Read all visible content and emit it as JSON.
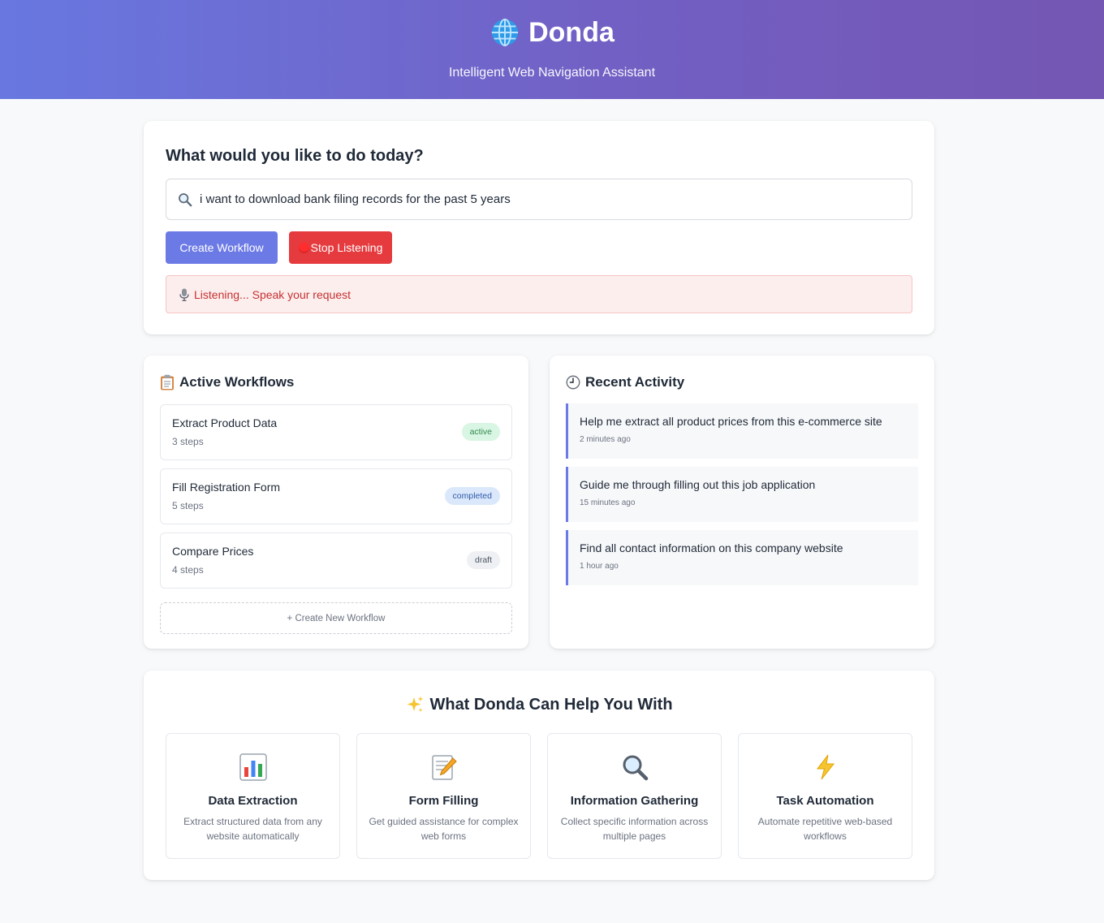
{
  "header": {
    "title": "Donda",
    "tagline": "Intelligent Web Navigation Assistant",
    "logo_icon": "globe-icon"
  },
  "query": {
    "title": "What would you like to do today?",
    "input_value": "i want to download bank filing records for the past 5 years",
    "search_icon": "search-icon",
    "create_button": "Create Workflow",
    "stop_button": "Stop Listening",
    "stop_icon": "red-circle-icon",
    "listening_status": "Listening... Speak your request",
    "listening_icon": "microphone-icon"
  },
  "workflows": {
    "title": "Active Workflows",
    "title_icon": "clipboard-icon",
    "items": [
      {
        "name": "Extract Product Data",
        "steps": "3 steps",
        "status": "active"
      },
      {
        "name": "Fill Registration Form",
        "steps": "5 steps",
        "status": "completed"
      },
      {
        "name": "Compare Prices",
        "steps": "4 steps",
        "status": "draft"
      }
    ],
    "new_button": "+ Create New Workflow"
  },
  "activity": {
    "title": "Recent Activity",
    "title_icon": "clock-icon",
    "items": [
      {
        "text": "Help me extract all product prices from this e-commerce site",
        "time": "2 minutes ago"
      },
      {
        "text": "Guide me through filling out this job application",
        "time": "15 minutes ago"
      },
      {
        "text": "Find all contact information on this company website",
        "time": "1 hour ago"
      }
    ]
  },
  "help": {
    "title": "What Donda Can Help You With",
    "title_icon": "sparkles-icon",
    "features": [
      {
        "icon": "bar-chart-icon",
        "title": "Data Extraction",
        "desc": "Extract structured data from any website automatically"
      },
      {
        "icon": "memo-icon",
        "title": "Form Filling",
        "desc": "Get guided assistance for complex web forms"
      },
      {
        "icon": "magnifier-icon",
        "title": "Information Gathering",
        "desc": "Collect specific information across multiple pages"
      },
      {
        "icon": "lightning-icon",
        "title": "Task Automation",
        "desc": "Automate repetitive web-based workflows"
      }
    ]
  },
  "colors": {
    "header_gradient_start": "#6878e0",
    "header_gradient_end": "#7456b3",
    "primary": "#6c7ae6",
    "danger": "#e53a3e",
    "active_badge": "#d9f5e3",
    "completed_badge": "#dbe8fb",
    "draft_badge": "#eef0f3"
  }
}
